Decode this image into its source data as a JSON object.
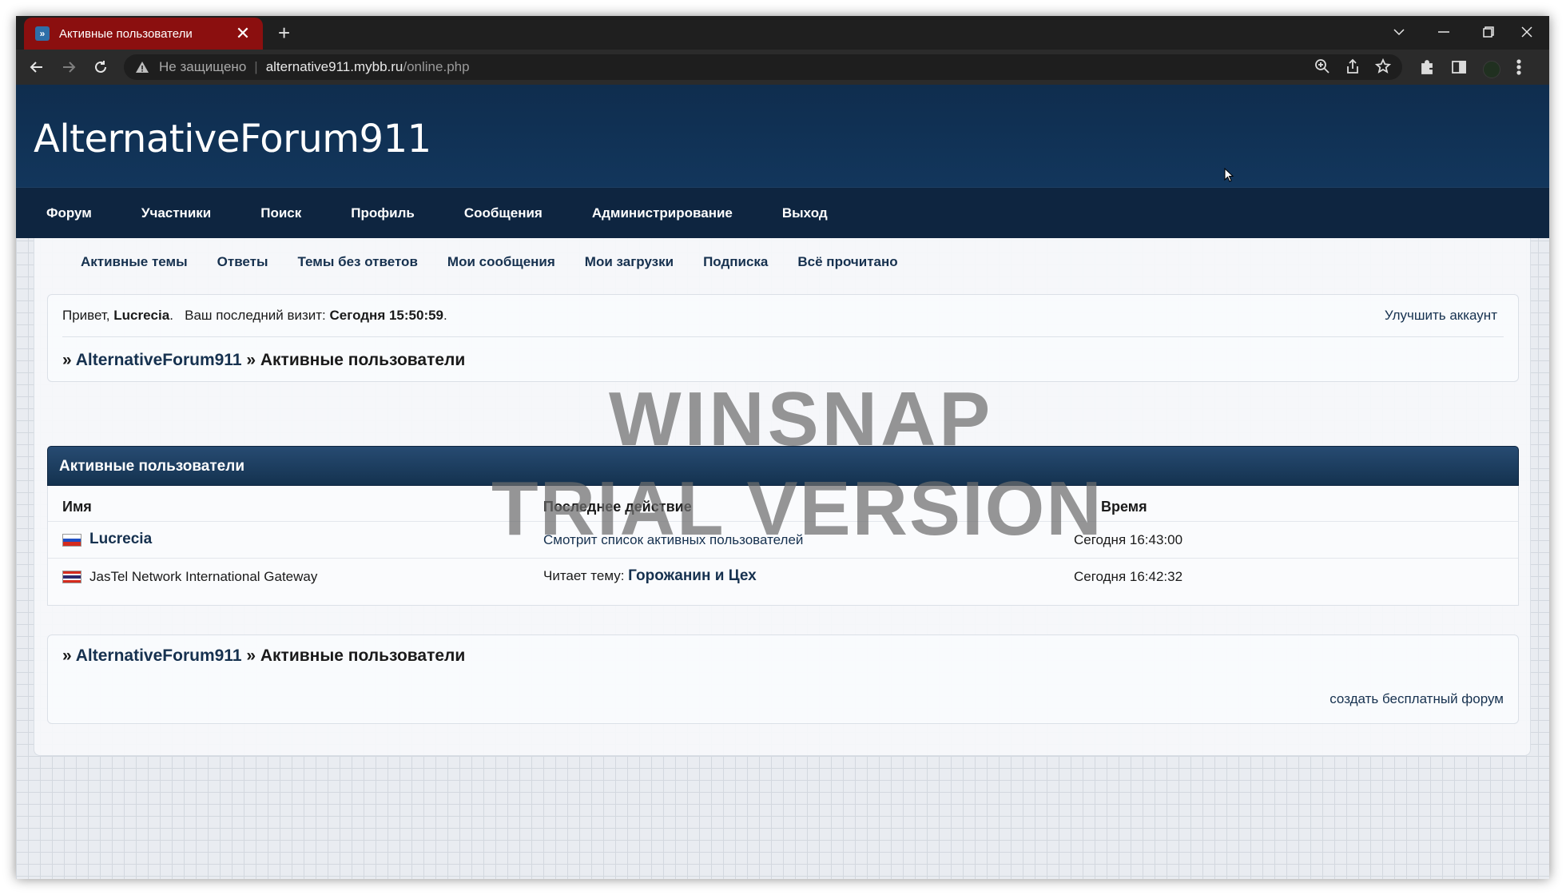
{
  "browser": {
    "tab_title": "Активные пользователи",
    "tab_favicon": "mybb-icon",
    "address": {
      "security_label": "Не защищено",
      "separator": "|",
      "host": "alternative911.mybb.ru",
      "path": "/online.php"
    }
  },
  "forum": {
    "logo": "AlternativeForum911",
    "main_nav": [
      "Форум",
      "Участники",
      "Поиск",
      "Профиль",
      "Сообщения",
      "Администрирование",
      "Выход"
    ],
    "sub_nav": [
      "Активные темы",
      "Ответы",
      "Темы без ответов",
      "Мои сообщения",
      "Мои загрузки",
      "Подписка",
      "Всё прочитано"
    ],
    "welcome": {
      "greeting": "Привет,",
      "username": "Lucrecia",
      "last_visit_label": "Ваш последний визит:",
      "last_visit_value": "Сегодня 15:50:59",
      "upgrade_link": "Улучшить аккаунт"
    },
    "breadcrumb": {
      "prefix": "»",
      "root": "AlternativeForum911",
      "separator": "»",
      "current": "Активные пользователи"
    },
    "online_table": {
      "title": "Активные пользователи",
      "headers": {
        "name": "Имя",
        "action": "Последнее действие",
        "time": "Время"
      },
      "rows": [
        {
          "flag": "russia-flag",
          "name": "Lucrecia",
          "action_link": "Смотрит список активных пользователей",
          "time": "Сегодня 16:43:00"
        },
        {
          "flag": "thailand-flag",
          "name": "JasTel Network International Gateway",
          "action_prefix": "Читает тему:",
          "action_topic": "Горожанин и Цех",
          "time": "Сегодня 16:42:32"
        }
      ]
    },
    "footer_link": "создать бесплатный форум"
  },
  "watermark": {
    "line1": "WINSNAP",
    "line2": "TRIAL VERSION"
  },
  "colors": {
    "header": "#0f2d4e",
    "nav": "#0e2540",
    "link": "#16314f",
    "tab_active": "#8b0f0f"
  }
}
